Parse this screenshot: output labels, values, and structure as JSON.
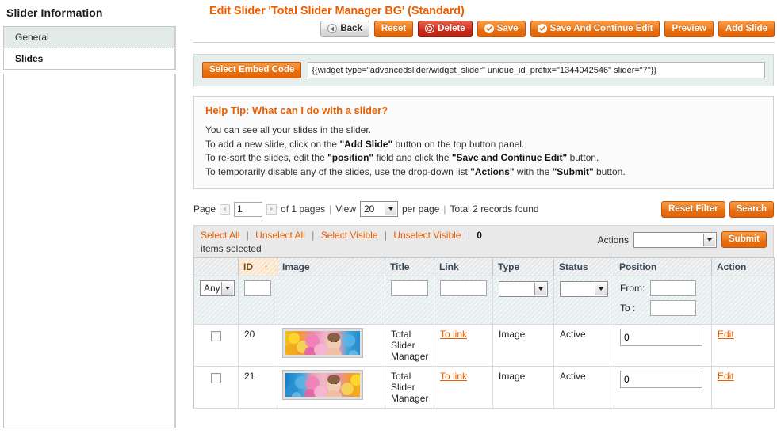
{
  "sidebar": {
    "title": "Slider Information",
    "items": [
      {
        "label": "General",
        "state": "normal"
      },
      {
        "label": "Slides",
        "state": "active"
      }
    ]
  },
  "header": {
    "page_title": "Edit Slider 'Total Slider Manager BG' (Standard)",
    "buttons": [
      {
        "label": "Back",
        "style": "gray",
        "icon": "back-arrow-icon"
      },
      {
        "label": "Reset",
        "style": "orange",
        "icon": ""
      },
      {
        "label": "Delete",
        "style": "red",
        "icon": "delete-circle-icon"
      },
      {
        "label": "Save",
        "style": "orange",
        "icon": "check-circle-icon"
      },
      {
        "label": "Save And Continue Edit",
        "style": "orange",
        "icon": "check-circle-icon"
      },
      {
        "label": "Preview",
        "style": "orange",
        "icon": ""
      },
      {
        "label": "Add Slide",
        "style": "orange",
        "icon": ""
      }
    ]
  },
  "embed": {
    "button_label": "Select Embed Code",
    "value": "{{widget type=\"advancedslider/widget_slider\" unique_id_prefix=\"1344042546\" slider=\"7\"}}",
    "placeholder": ""
  },
  "help": {
    "title": "Help Tip: What can I do with a slider?",
    "lines": [
      "You can see all your slides in the slider.",
      "To add a new slide, click on the \"Add Slide\" button on the top button panel.",
      "To re-sort the slides, edit the \"position\" field and click the \"Save and Continue Edit\" button.",
      "To temporarily disable any of the slides, use the drop-down list \"Actions\" with the \"Submit\" button."
    ]
  },
  "pager": {
    "page_label": "Page",
    "page_value": "1",
    "of_pages": "of 1 pages",
    "sep1": "|",
    "view_label": "View",
    "view_value": "20",
    "per_page_label": "per page",
    "sep2": "|",
    "total_label": "Total 2 records found",
    "reset_filter_label": "Reset Filter",
    "search_label": "Search"
  },
  "massaction": {
    "select_all": "Select All",
    "unselect_all": "Unselect All",
    "select_visible": "Select Visible",
    "unselect_visible": "Unselect Visible",
    "count": "0",
    "items_selected": "items selected",
    "actions_label": "Actions",
    "actions_value": "",
    "submit_label": "Submit"
  },
  "grid": {
    "columns": [
      {
        "label": "",
        "key": "checkbox",
        "sorted": false
      },
      {
        "label": "ID",
        "key": "id",
        "sorted": true,
        "sort_dir": "↑"
      },
      {
        "label": "Image",
        "key": "image",
        "sorted": false
      },
      {
        "label": "Title",
        "key": "title",
        "sorted": false
      },
      {
        "label": "Link",
        "key": "link",
        "sorted": false
      },
      {
        "label": "Type",
        "key": "type",
        "sorted": false
      },
      {
        "label": "Status",
        "key": "status",
        "sorted": false
      },
      {
        "label": "Position",
        "key": "position",
        "sorted": false
      },
      {
        "label": "Action",
        "key": "action",
        "sorted": false
      }
    ],
    "filters": {
      "checkbox_select_value": "Any",
      "id_value": "",
      "title_value": "",
      "link_value": "",
      "type_value": "",
      "status_value": "",
      "position_from_label": "From:",
      "position_from_value": "",
      "position_to_label": "To :",
      "position_to_value": ""
    },
    "rows": [
      {
        "checked": false,
        "id": "20",
        "image_alt": "slide-thumbnail",
        "image_variant": "normal",
        "title": "Total Slider Manager",
        "link": "To link",
        "type": "Image",
        "status": "Active",
        "position": "0",
        "action": "Edit"
      },
      {
        "checked": false,
        "id": "21",
        "image_alt": "slide-thumbnail",
        "image_variant": "mirrored",
        "title": "Total Slider Manager",
        "link": "To link",
        "type": "Image",
        "status": "Active",
        "position": "0",
        "action": "Edit"
      }
    ]
  },
  "colors": {
    "accent_orange": "#eb5e00",
    "button_orange": "#e8700f",
    "button_red": "#c92c1a",
    "sorted_header": "#fbe3c8",
    "filter_row": "#e4edee",
    "embed_bg": "#e7efee"
  }
}
